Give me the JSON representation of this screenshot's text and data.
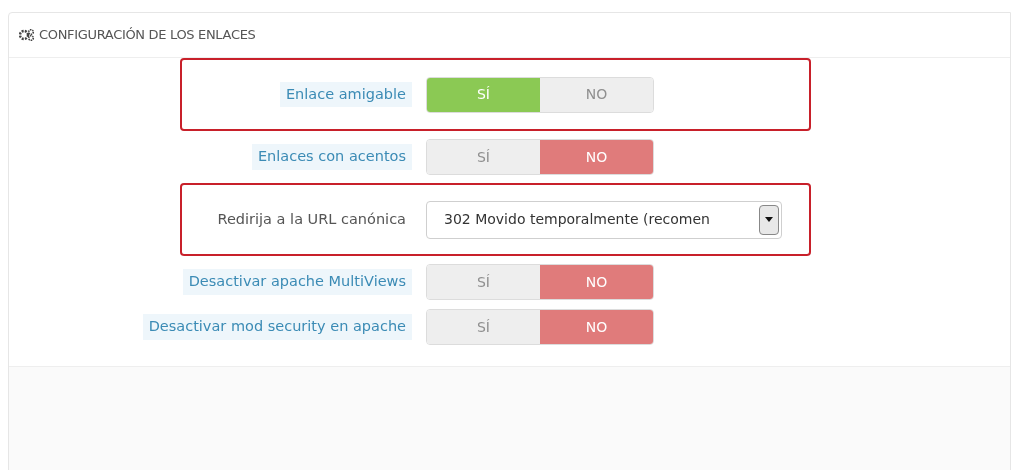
{
  "panel": {
    "title": "CONFIGURACIÓN DE LOS ENLACES"
  },
  "rows": [
    {
      "kind": "switch",
      "label": "Enlace amigable",
      "hint": true,
      "highlighted": true,
      "on": true,
      "yes": "SÍ",
      "no": "NO"
    },
    {
      "kind": "switch",
      "label": "Enlaces con acentos",
      "hint": true,
      "highlighted": false,
      "on": false,
      "yes": "SÍ",
      "no": "NO"
    },
    {
      "kind": "select",
      "label": "Redirija a la URL canónica",
      "hint": false,
      "highlighted": true,
      "value": "302 Movido temporalmente (recomen"
    },
    {
      "kind": "switch",
      "label": "Desactivar apache MultiViews",
      "hint": true,
      "highlighted": false,
      "on": false,
      "yes": "SÍ",
      "no": "NO"
    },
    {
      "kind": "switch",
      "label": "Desactivar mod security en apache",
      "hint": true,
      "highlighted": false,
      "on": false,
      "yes": "SÍ",
      "no": "NO"
    }
  ]
}
